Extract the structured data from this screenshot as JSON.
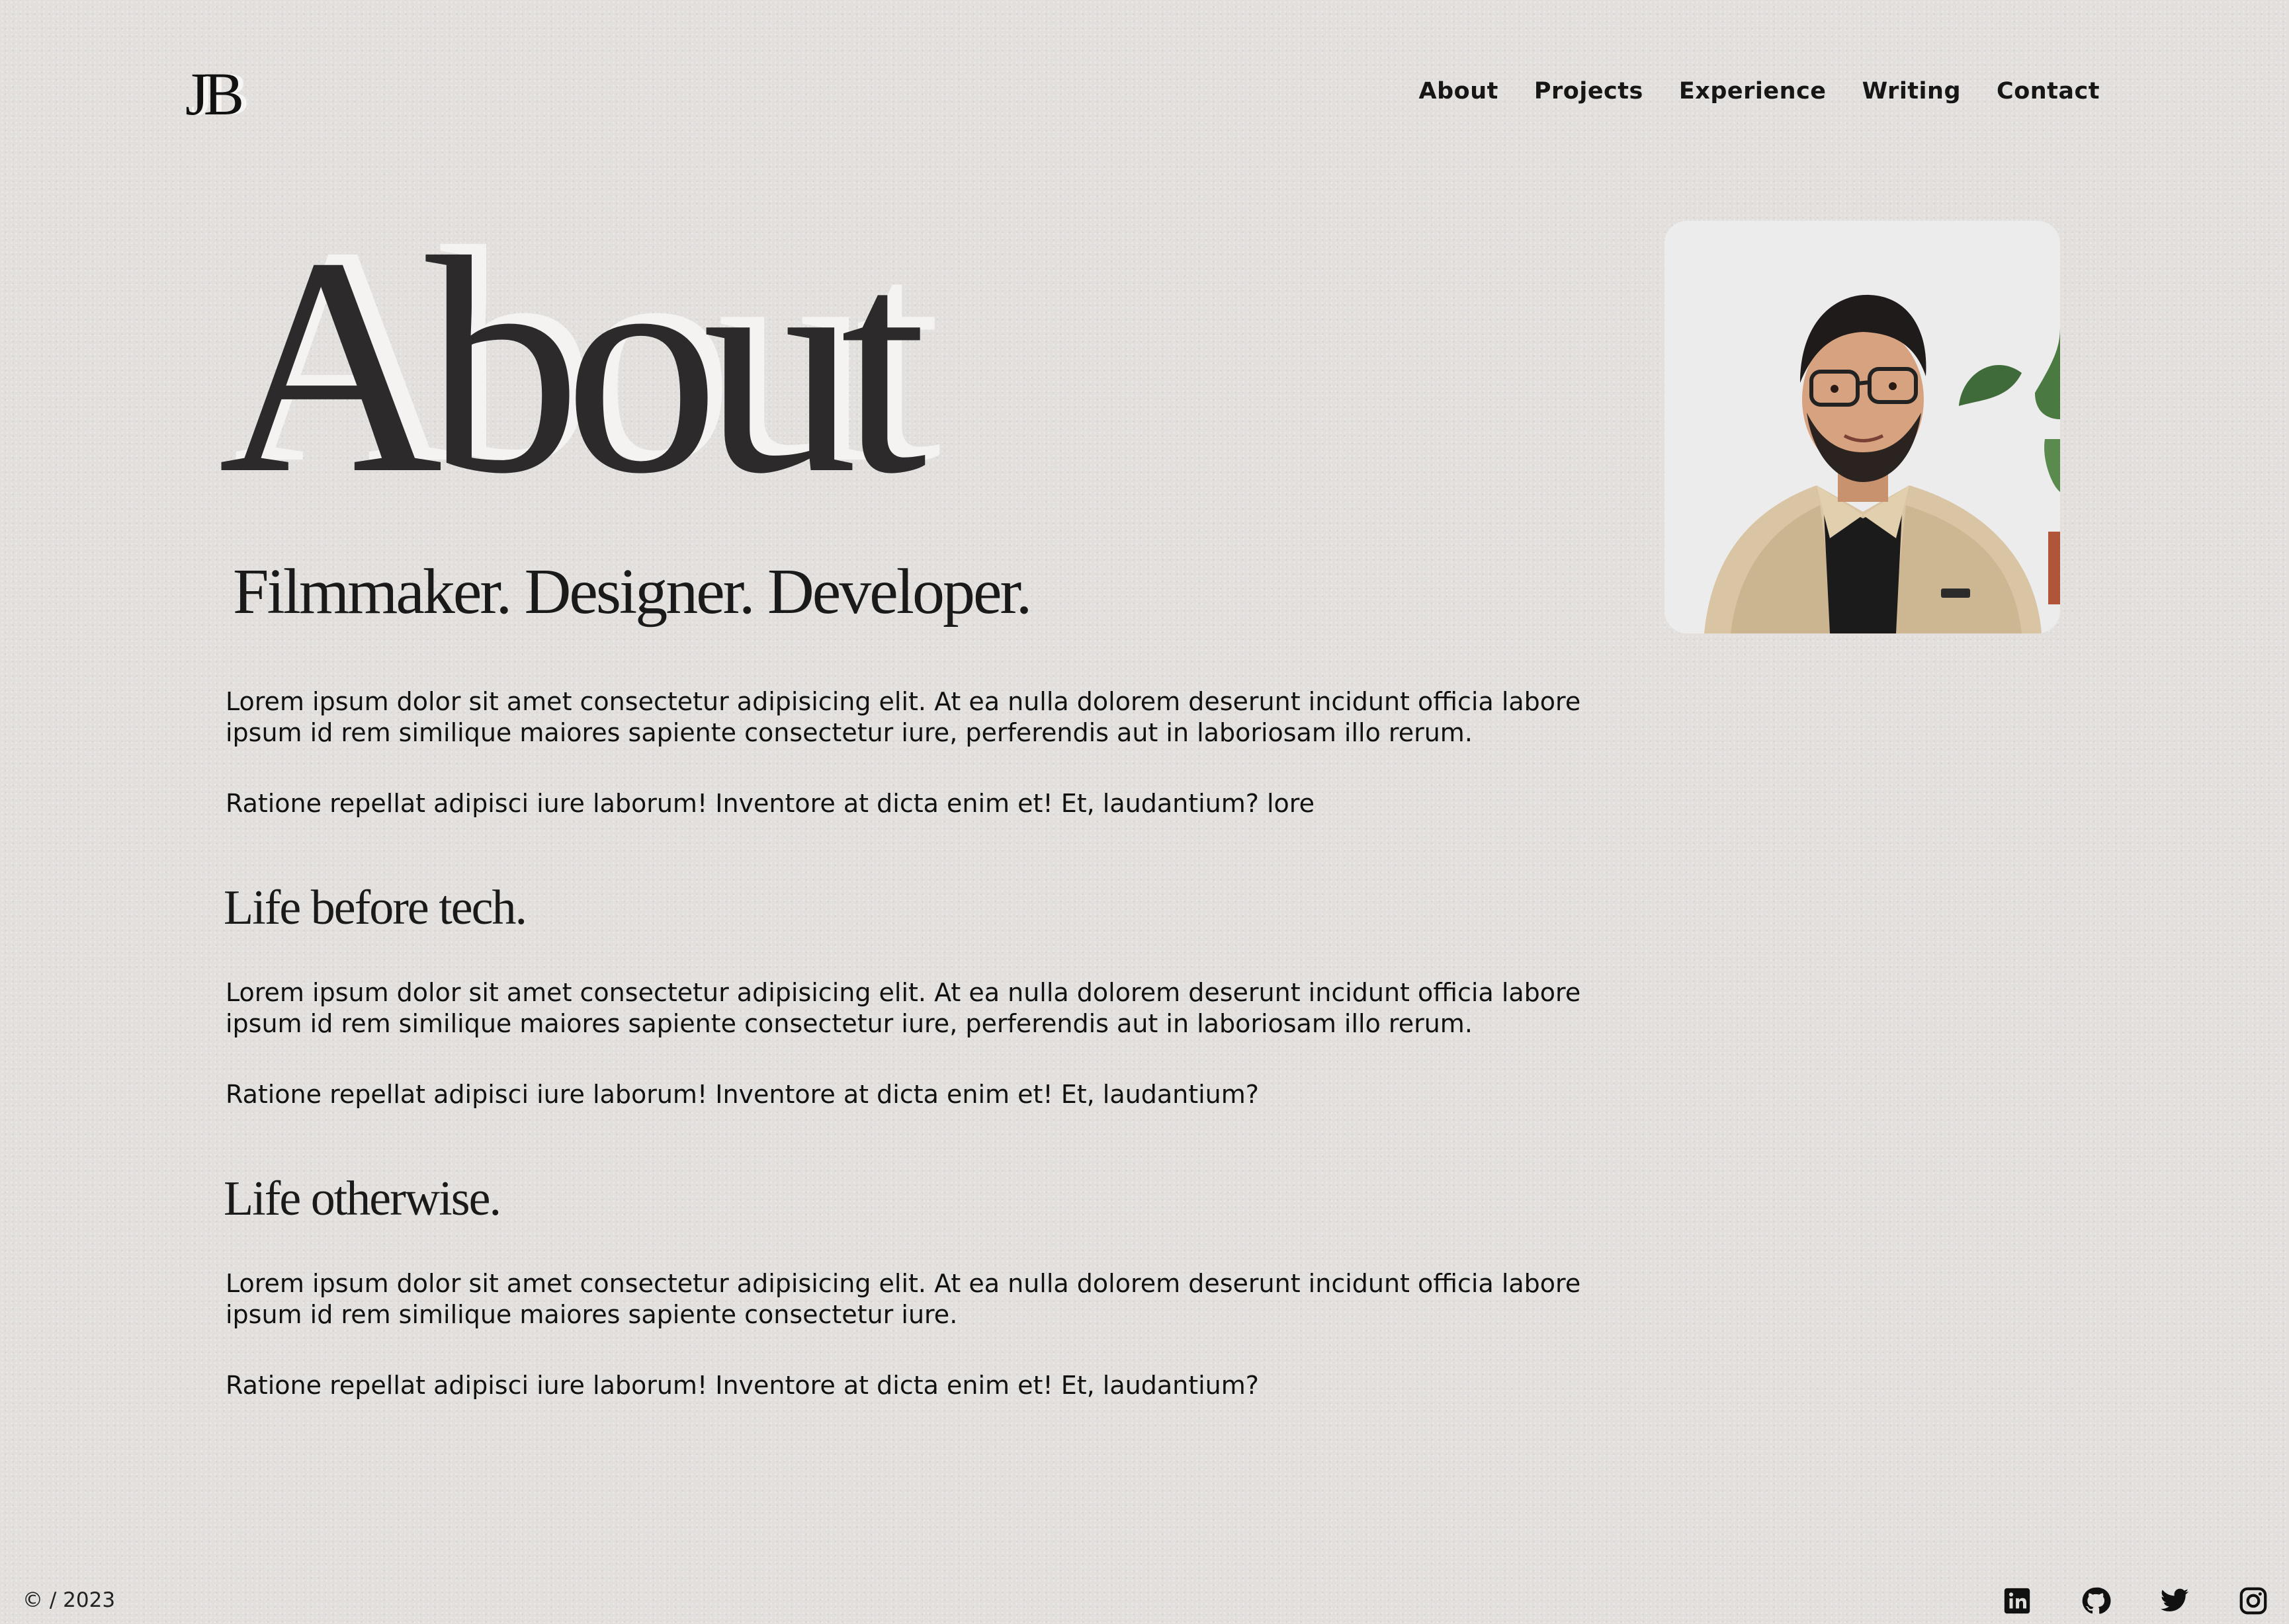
{
  "header": {
    "logo": "JB",
    "nav": [
      "About",
      "Projects",
      "Experience",
      "Writing",
      "Contact"
    ]
  },
  "main": {
    "title": "About",
    "tagline": "Filmmaker. Designer. Developer.",
    "intro": [
      "Lorem ipsum dolor sit amet consectetur adipisicing elit. At ea nulla dolorem deserunt incidunt officia labore ipsum id rem similique maiores sapiente consectetur iure, perferendis aut in laboriosam illo rerum.",
      "Ratione repellat adipisci iure laborum! Inventore at dicta enim et! Et, laudantium? lore"
    ],
    "sections": [
      {
        "heading": "Life before tech.",
        "paragraphs": [
          "Lorem ipsum dolor sit amet consectetur adipisicing elit. At ea nulla dolorem deserunt incidunt officia labore ipsum id rem similique maiores sapiente consectetur iure, perferendis aut in laboriosam illo rerum.",
          "Ratione repellat adipisci iure laborum! Inventore at dicta enim et! Et, laudantium?"
        ]
      },
      {
        "heading": "Life otherwise.",
        "paragraphs": [
          "Lorem ipsum dolor sit amet consectetur adipisicing elit. At ea nulla dolorem deserunt incidunt officia labore ipsum id rem similique maiores sapiente consectetur iure.",
          "Ratione repellat adipisci iure laborum! Inventore at dicta enim et! Et, laudantium?"
        ]
      }
    ]
  },
  "footer": {
    "copyright": "© / 2023",
    "social": [
      "linkedin-icon",
      "github-icon",
      "twitter-icon",
      "instagram-icon"
    ]
  },
  "colors": {
    "background": "#e2dfdd",
    "text": "#151515",
    "heading": "#2c2a2b",
    "highlight": "#f4f3f2"
  }
}
